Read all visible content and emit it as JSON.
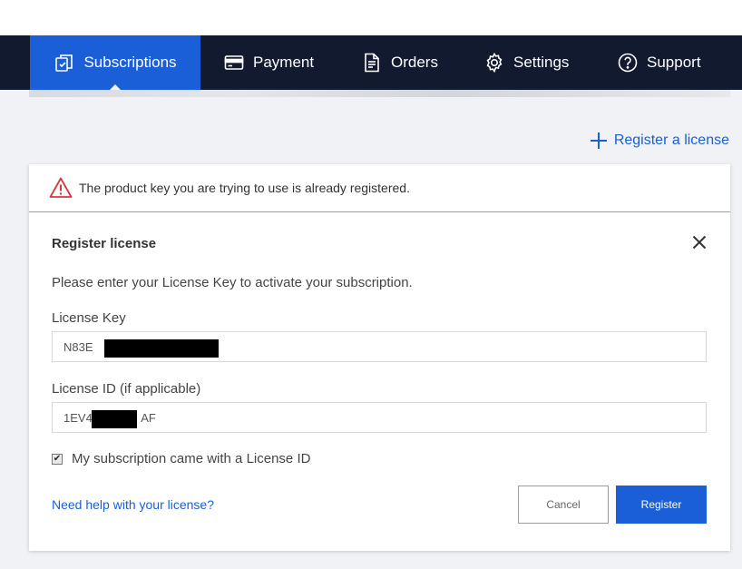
{
  "nav": {
    "items": [
      {
        "label": "Subscriptions",
        "icon": "subscriptions-icon",
        "active": true
      },
      {
        "label": "Payment",
        "icon": "card-icon",
        "active": false
      },
      {
        "label": "Orders",
        "icon": "document-icon",
        "active": false
      },
      {
        "label": "Settings",
        "icon": "gear-icon",
        "active": false
      },
      {
        "label": "Support",
        "icon": "help-icon",
        "active": false
      }
    ]
  },
  "register_link": {
    "label": "Register a license",
    "icon": "plus-icon"
  },
  "alert": {
    "message": "The product key you are trying to use is already registered.",
    "icon": "warning-icon"
  },
  "dialog": {
    "title": "Register license",
    "intro": "Please enter your License Key to activate your subscription.",
    "license_key": {
      "label": "License Key",
      "value": "N83E                        1P"
    },
    "license_id": {
      "label": "License ID (if applicable)",
      "value": "1EV4               AF"
    },
    "checkbox": {
      "label": "My subscription came with a License ID",
      "checked": true
    },
    "help_link": "Need help with your license?",
    "cancel_label": "Cancel",
    "register_label": "Register"
  },
  "colors": {
    "nav_bg": "#111a2e",
    "accent": "#1a5fd8",
    "warning": "#d9363e"
  }
}
